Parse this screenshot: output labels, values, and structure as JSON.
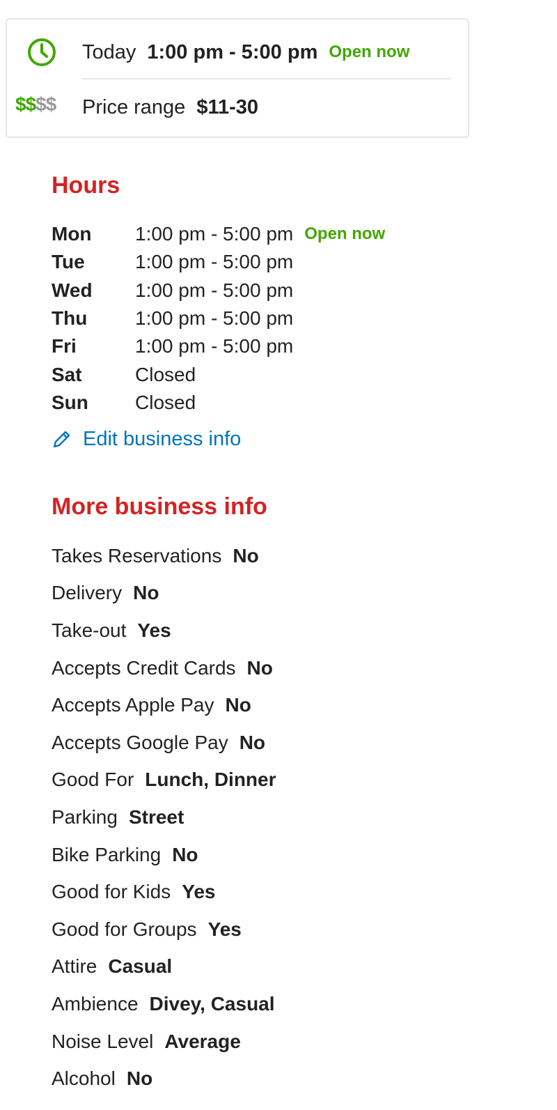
{
  "summary": {
    "today_label": "Today",
    "today_hours": "1:00 pm - 5:00 pm",
    "open_status": "Open now",
    "price_icon": "$$$$",
    "price_level_filled": 2,
    "price_label": "Price range",
    "price_value": "$11-30"
  },
  "hours": {
    "title": "Hours",
    "rows": [
      {
        "day": "Mon",
        "time": "1:00 pm - 5:00 pm",
        "status": "Open now"
      },
      {
        "day": "Tue",
        "time": "1:00 pm - 5:00 pm",
        "status": ""
      },
      {
        "day": "Wed",
        "time": "1:00 pm - 5:00 pm",
        "status": ""
      },
      {
        "day": "Thu",
        "time": "1:00 pm - 5:00 pm",
        "status": ""
      },
      {
        "day": "Fri",
        "time": "1:00 pm - 5:00 pm",
        "status": ""
      },
      {
        "day": "Sat",
        "time": "Closed",
        "status": ""
      },
      {
        "day": "Sun",
        "time": "Closed",
        "status": ""
      }
    ],
    "edit_label": "Edit business info"
  },
  "more_info": {
    "title": "More business info",
    "items": [
      {
        "label": "Takes Reservations",
        "value": "No"
      },
      {
        "label": "Delivery",
        "value": "No"
      },
      {
        "label": "Take-out",
        "value": "Yes"
      },
      {
        "label": "Accepts Credit Cards",
        "value": "No"
      },
      {
        "label": "Accepts Apple Pay",
        "value": "No"
      },
      {
        "label": "Accepts Google Pay",
        "value": "No"
      },
      {
        "label": "Good For",
        "value": "Lunch, Dinner"
      },
      {
        "label": "Parking",
        "value": "Street"
      },
      {
        "label": "Bike Parking",
        "value": "No"
      },
      {
        "label": "Good for Kids",
        "value": "Yes"
      },
      {
        "label": "Good for Groups",
        "value": "Yes"
      },
      {
        "label": "Attire",
        "value": "Casual"
      },
      {
        "label": "Ambience",
        "value": "Divey, Casual"
      },
      {
        "label": "Noise Level",
        "value": "Average"
      },
      {
        "label": "Alcohol",
        "value": "No"
      }
    ]
  },
  "colors": {
    "heading": "#d32323",
    "open": "#41a700",
    "link": "#0073bb",
    "price_inactive": "#999999"
  },
  "icons": {
    "clock": "clock-icon",
    "price": "price-range-icon",
    "edit": "pencil-icon"
  }
}
